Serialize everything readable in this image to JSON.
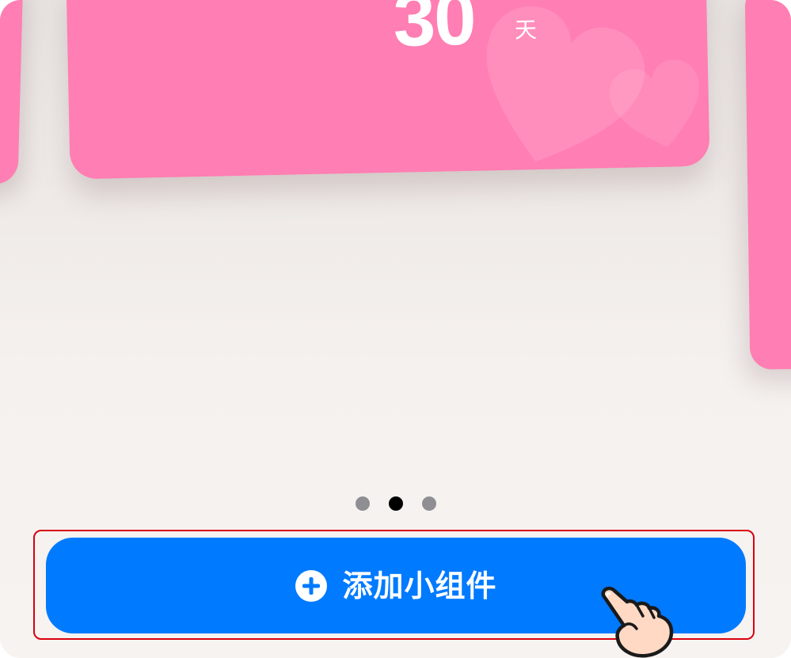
{
  "widget_preview": {
    "count_value": "30",
    "count_unit": "天",
    "card_color": "#ff7eb3",
    "decoration_icon": "heart-icon"
  },
  "pagination": {
    "total": 3,
    "active_index": 1
  },
  "add_widget_button": {
    "label": "添加小组件",
    "icon": "plus-circle-icon",
    "color": "#007aff"
  },
  "tutorial_overlay": {
    "pointer_icon": "tap-hand-icon",
    "highlight_color": "#d9000f"
  }
}
